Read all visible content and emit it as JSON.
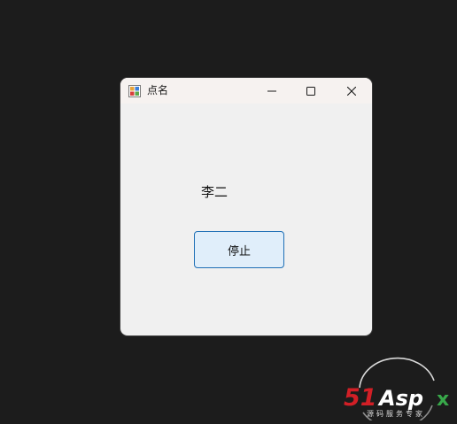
{
  "window": {
    "title": "点名",
    "app_icon": "winforms-app-icon",
    "caption_buttons": [
      "minimize-icon",
      "maximize-icon",
      "close-icon"
    ]
  },
  "content": {
    "name_label": "李二",
    "stop_button_label": "停止"
  },
  "watermark": {
    "brand": "51Aspx",
    "brand_number": "51",
    "brand_text": "Asp",
    "brand_x": "x",
    "subtitle": "源码服务专家"
  },
  "colors": {
    "desktop": "#1c1c1c",
    "window_bg": "#f0f0f0",
    "titlebar_bg": "#f6f2f0",
    "button_border": "#1f6fb5",
    "button_bg": "#e0eefa",
    "watermark_red": "#d21f26",
    "watermark_green": "#38a84a"
  }
}
